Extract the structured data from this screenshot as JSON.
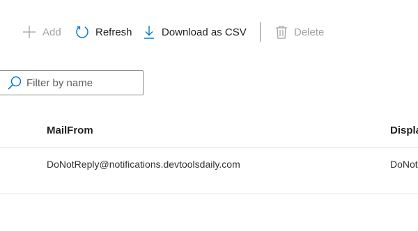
{
  "toolbar": {
    "add_label": "Add",
    "refresh_label": "Refresh",
    "download_label": "Download as CSV",
    "delete_label": "Delete"
  },
  "filter": {
    "placeholder": "Filter by name",
    "value": ""
  },
  "table": {
    "columns": [
      "MailFrom",
      "Displa"
    ],
    "rows": [
      [
        "DoNotReply@notifications.devtoolsdaily.com",
        "DoNot"
      ]
    ]
  },
  "colors": {
    "accent": "#0078d4",
    "disabled": "#a19f9d",
    "text": "#201f1e"
  },
  "icons": [
    "add-icon",
    "refresh-icon",
    "download-icon",
    "delete-icon",
    "search-icon"
  ]
}
